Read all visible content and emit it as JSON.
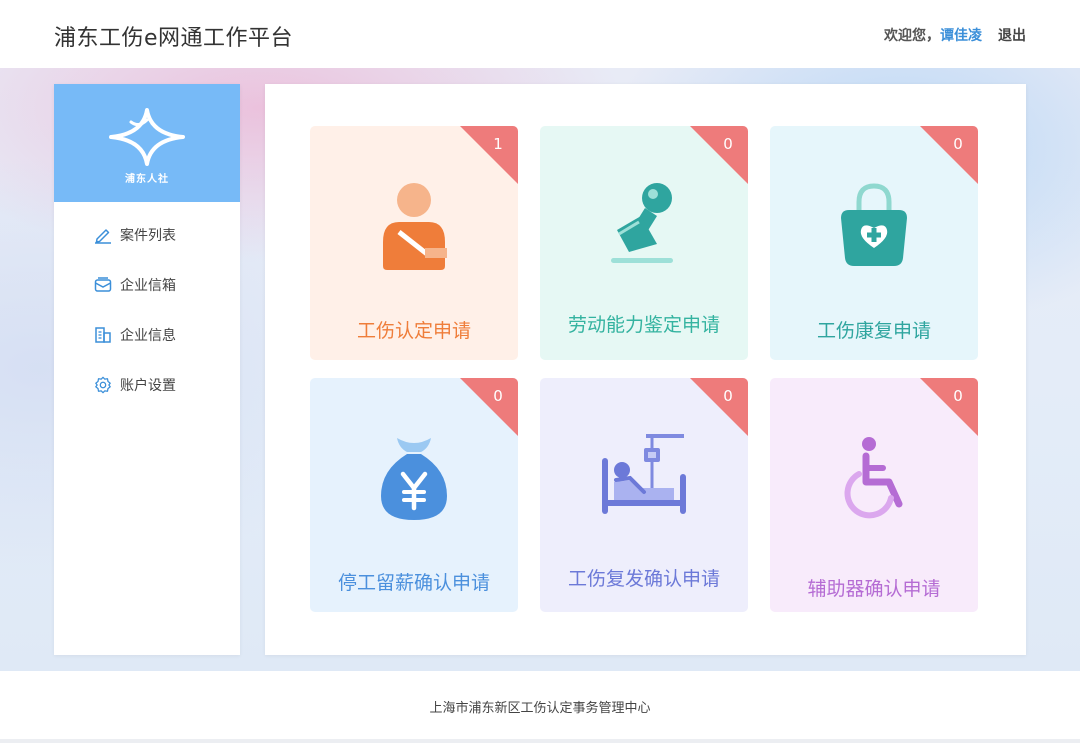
{
  "header": {
    "title": "浦东工伤e网通工作平台",
    "welcome": "欢迎您，",
    "username": "谭佳凌",
    "logout": "退出"
  },
  "sidebar": {
    "logo_text": "浦东人社",
    "items": [
      {
        "label": "案件列表",
        "icon": "pencil-icon"
      },
      {
        "label": "企业信箱",
        "icon": "mailbox-icon"
      },
      {
        "label": "企业信息",
        "icon": "building-icon"
      },
      {
        "label": "账户设置",
        "icon": "gear-icon"
      }
    ]
  },
  "cards": [
    {
      "label": "工伤认定申请",
      "count": "1",
      "icon": "injured-person-icon",
      "bg": "#fff0e8",
      "color": "#ef7d3a"
    },
    {
      "label": "劳动能力鉴定申请",
      "count": "0",
      "icon": "stamp-icon",
      "bg": "#e6f8f4",
      "color": "#34b3a0"
    },
    {
      "label": "工伤康复申请",
      "count": "0",
      "icon": "medical-bag-icon",
      "bg": "#e6f6fb",
      "color": "#2fa59f"
    },
    {
      "label": "停工留薪确认申请",
      "count": "0",
      "icon": "money-bag-icon",
      "bg": "#e6f2fd",
      "color": "#4b90dd"
    },
    {
      "label": "工伤复发确认申请",
      "count": "0",
      "icon": "hospital-bed-icon",
      "bg": "#eeeefc",
      "color": "#6c79d8"
    },
    {
      "label": "辅助器确认申请",
      "count": "0",
      "icon": "wheelchair-icon",
      "bg": "#f8ebfb",
      "color": "#b56cd4"
    }
  ],
  "colors": {
    "accent": "#77baf7",
    "badge": "#ee7b7b",
    "username": "#3b8fd9"
  },
  "footer": {
    "text": "上海市浦东新区工伤认定事务管理中心"
  }
}
